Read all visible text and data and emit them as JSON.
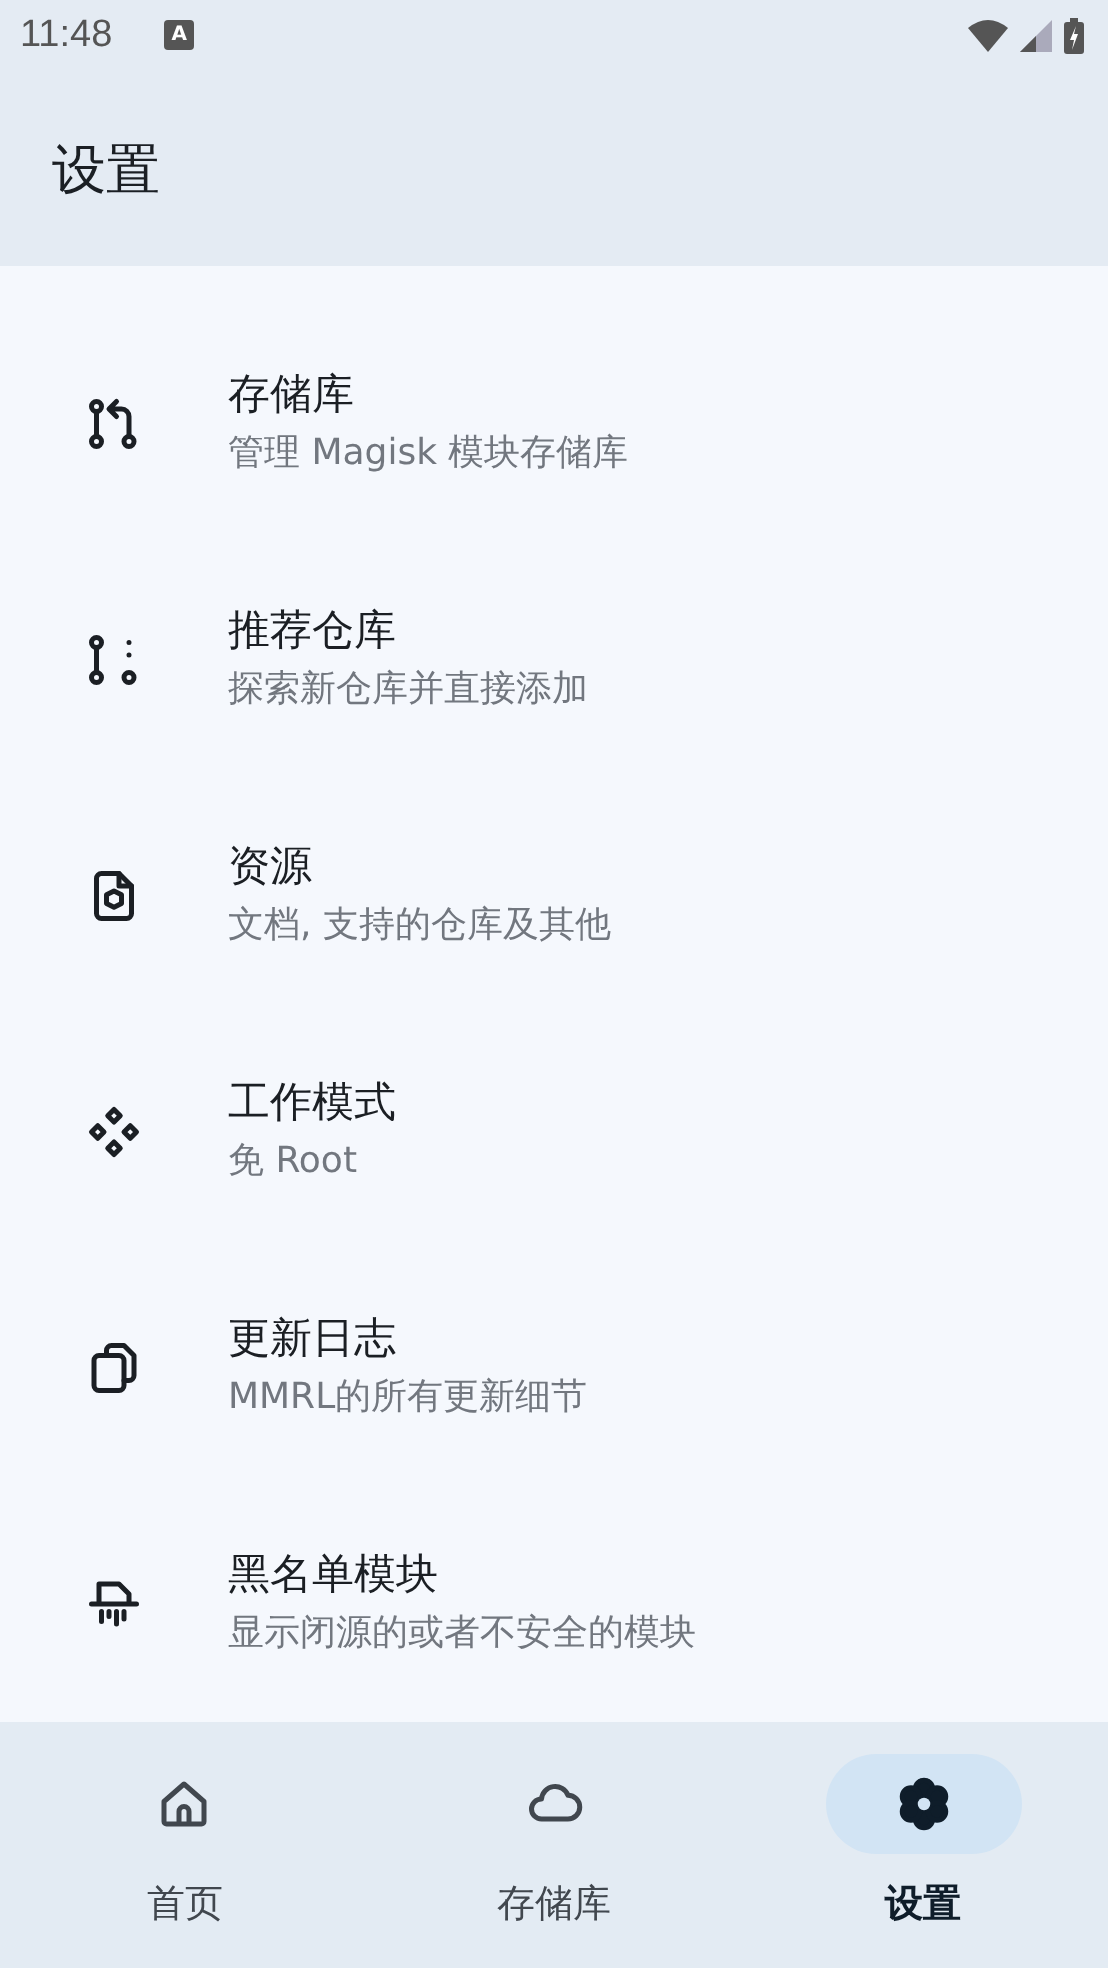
{
  "status_bar": {
    "time": "11:48",
    "badge": "A"
  },
  "app_bar": {
    "title": "设置"
  },
  "settings": [
    {
      "title": "存储库",
      "subtitle": "管理 Magisk 模块存储库"
    },
    {
      "title": "推荐仓库",
      "subtitle": "探索新仓库并直接添加"
    },
    {
      "title": "资源",
      "subtitle": "文档, 支持的仓库及其他"
    },
    {
      "title": "工作模式",
      "subtitle": "免 Root"
    },
    {
      "title": "更新日志",
      "subtitle": "MMRL的所有更新细节"
    },
    {
      "title": "黑名单模块",
      "subtitle": "显示闭源的或者不安全的模块"
    }
  ],
  "nav": [
    {
      "label": "首页",
      "selected": false
    },
    {
      "label": "存储库",
      "selected": false
    },
    {
      "label": "设置",
      "selected": true
    }
  ]
}
